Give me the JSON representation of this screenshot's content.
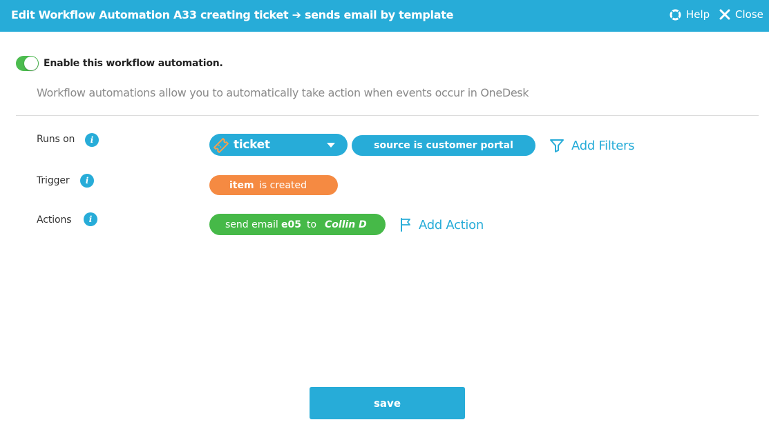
{
  "header": {
    "title": "Edit Workflow Automation A33 creating ticket ➔ sends email by template",
    "help_label": "Help",
    "close_label": "Close"
  },
  "enable": {
    "label": "Enable this workflow automation.",
    "enabled": true
  },
  "description": "Workflow automations allow you to automatically take action when events occur in OneDesk",
  "rows": {
    "runs_on": {
      "label": "Runs on",
      "selected_type": "ticket",
      "filter": "source is customer portal",
      "add_filters_label": "Add Filters"
    },
    "trigger": {
      "label": "Trigger",
      "subject": "item",
      "event": "is created"
    },
    "actions": {
      "label": "Actions",
      "action": "send email",
      "template": "e05",
      "to_word": "to",
      "recipient": "Collin D",
      "add_action_label": "Add Action"
    }
  },
  "info_glyph": "i",
  "save_label": "save",
  "colors": {
    "header": "#27acd8",
    "toggle_on": "#4cbc4f",
    "pill_blue": "#27acd8",
    "pill_orange": "#f58a42",
    "pill_green": "#46b948",
    "link": "#27acd8"
  },
  "icons": {
    "help": "lifebuoy-icon",
    "close": "close-icon",
    "ticket": "ticket-icon",
    "filter": "funnel-icon",
    "action": "flag-icon",
    "info": "info-icon",
    "dropdown": "caret-down-icon"
  }
}
